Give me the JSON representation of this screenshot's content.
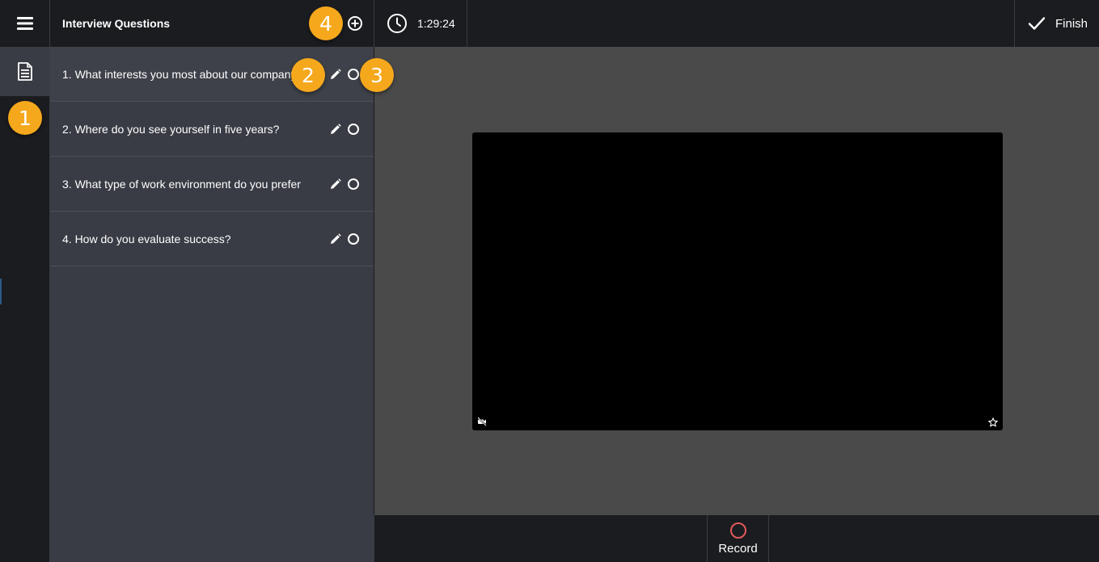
{
  "panel": {
    "title": "Interview Questions",
    "questions": [
      {
        "label": "1. What interests you most about our company?"
      },
      {
        "label": "2. Where do you see yourself in five years?"
      },
      {
        "label": "3. What type of work environment do you prefer?"
      },
      {
        "label": "4. How do you evaluate success?"
      }
    ]
  },
  "timer": {
    "value": "1:29:24"
  },
  "finish": {
    "label": "Finish"
  },
  "record": {
    "label": "Record"
  },
  "callouts": [
    "1",
    "2",
    "3",
    "4"
  ],
  "colors": {
    "background": "#1b1c20",
    "panel": "#393c44",
    "stage": "#4a4a4a",
    "callout": "#f5a81c",
    "record": "#e0595b"
  }
}
